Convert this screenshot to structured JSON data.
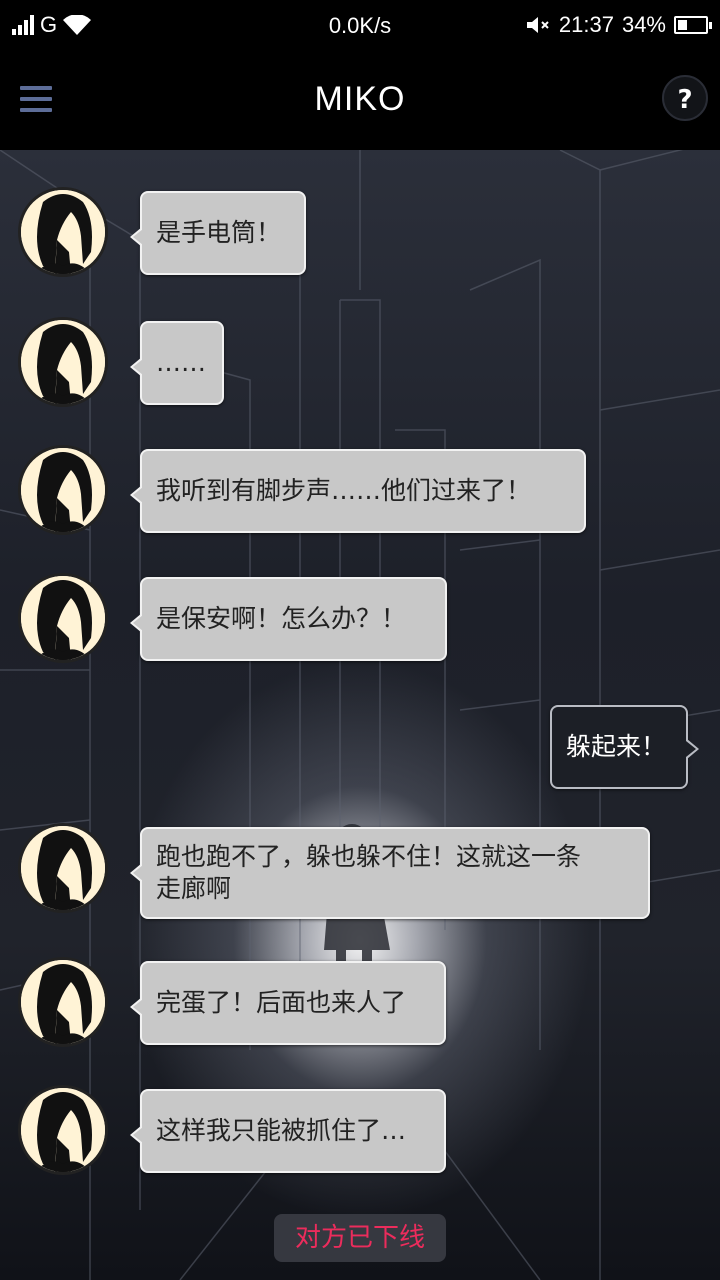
{
  "status_bar": {
    "carrier": "G",
    "speed": "0.0K/s",
    "time": "21:37",
    "battery": "34%",
    "battery_level": 0.34
  },
  "header": {
    "title": "MIKO",
    "menu_icon": "menu-icon",
    "help_icon": "help-icon",
    "help_glyph": "?"
  },
  "messages": [
    {
      "from": "miko",
      "text": "是手电筒！"
    },
    {
      "from": "miko",
      "text": "……"
    },
    {
      "from": "miko",
      "text": "我听到有脚步声……他们过来了！"
    },
    {
      "from": "miko",
      "text": "是保安啊！怎么办？！"
    },
    {
      "from": "me",
      "text": "躲起来！"
    },
    {
      "from": "miko",
      "text": "跑也跑不了，躲也躲不住！这就这一条\n走廊啊"
    },
    {
      "from": "miko",
      "text": "完蛋了！后面也来人了"
    },
    {
      "from": "miko",
      "text": "这样我只能被抓住了…"
    }
  ],
  "system_notice": "对方已下线",
  "colors": {
    "notice_text": "#ec2c5c",
    "menu_icon": "#5d6d98",
    "bubble_in": "#c8c8c8",
    "bubble_out": "#1c1f26"
  }
}
